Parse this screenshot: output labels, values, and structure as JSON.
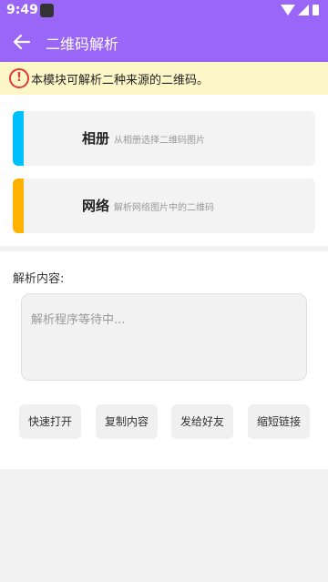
{
  "status_bar": {
    "time": "9:49"
  },
  "app_bar": {
    "title": "二维码解析"
  },
  "notice": {
    "text": "本模块可解析二种来源的二维码。",
    "color": "#e53935"
  },
  "sources": [
    {
      "title": "相册",
      "subtitle": "从相册选择二维码图片",
      "accent": "#00bfff"
    },
    {
      "title": "网络",
      "subtitle": "解析网络图片中的二维码",
      "accent": "#ffb300"
    }
  ],
  "content": {
    "label": "解析内容:",
    "placeholder": "解析程序等待中..."
  },
  "actions": [
    "快速打开",
    "复制内容",
    "发给好友",
    "缩短链接"
  ],
  "colors": {
    "primary": "#9966f7",
    "notice_bg": "#fdf7c8"
  }
}
